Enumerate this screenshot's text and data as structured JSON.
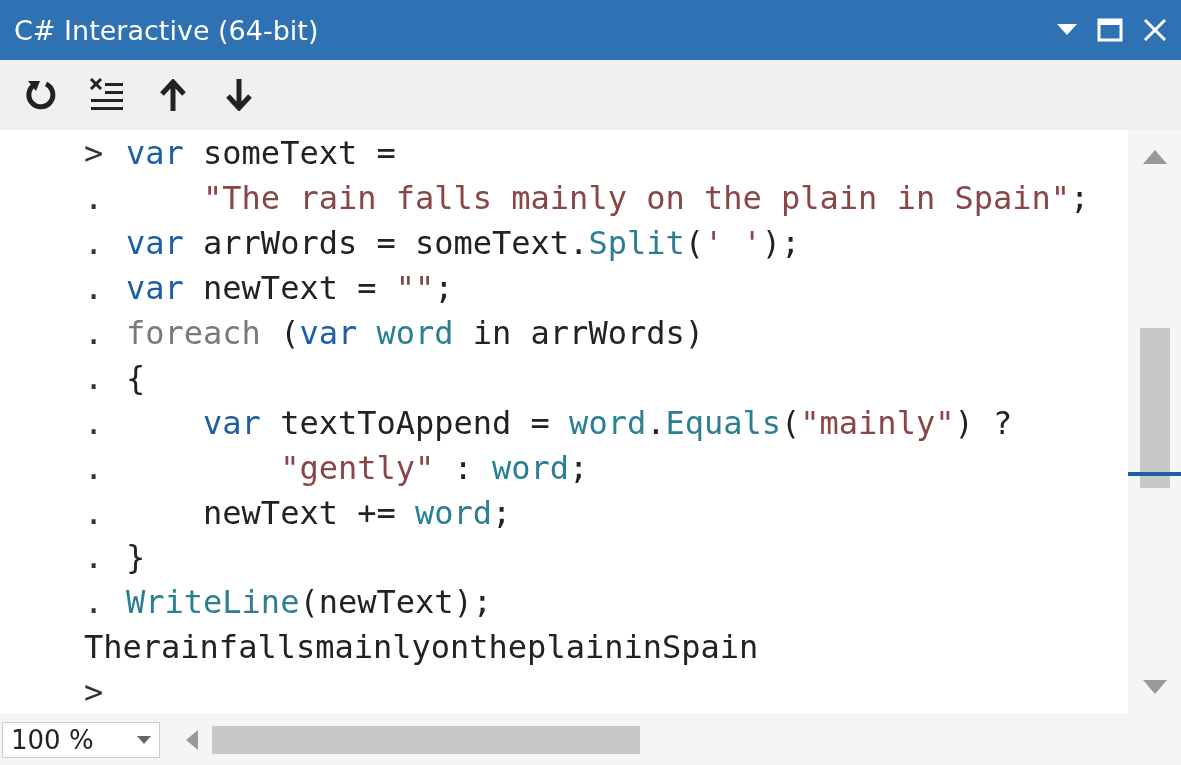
{
  "window": {
    "title": "C# Interactive (64-bit)"
  },
  "toolbar": {
    "buttons": [
      {
        "kind": "reset"
      },
      {
        "kind": "clear"
      },
      {
        "kind": "up"
      },
      {
        "kind": "down"
      }
    ]
  },
  "lines": [
    {
      "prompt": ">",
      "tokens": [
        {
          "kind": "keyword",
          "text": "var"
        },
        {
          "kind": "plain",
          "text": " someText ="
        }
      ]
    },
    {
      "prompt": ".",
      "tokens": [
        {
          "kind": "string",
          "text": "    \"The rain falls mainly on the plain in Spain\""
        },
        {
          "kind": "plain",
          "text": ";"
        }
      ]
    },
    {
      "prompt": ".",
      "tokens": [
        {
          "kind": "keyword",
          "text": "var"
        },
        {
          "kind": "plain",
          "text": " arrWords = someText."
        },
        {
          "kind": "method",
          "text": "Split"
        },
        {
          "kind": "plain",
          "text": "("
        },
        {
          "kind": "string",
          "text": "' '"
        },
        {
          "kind": "plain",
          "text": ");"
        }
      ]
    },
    {
      "prompt": ".",
      "tokens": [
        {
          "kind": "keyword",
          "text": "var"
        },
        {
          "kind": "plain",
          "text": " newText = "
        },
        {
          "kind": "string",
          "text": "\"\""
        },
        {
          "kind": "plain",
          "text": ";"
        }
      ]
    },
    {
      "prompt": ".",
      "tokens": [
        {
          "kind": "control",
          "text": "foreach"
        },
        {
          "kind": "plain",
          "text": " ("
        },
        {
          "kind": "keyword",
          "text": "var"
        },
        {
          "kind": "method",
          "text": " word"
        },
        {
          "kind": "plain",
          "text": " in arrWords)"
        }
      ]
    },
    {
      "prompt": ".",
      "tokens": [
        {
          "kind": "plain",
          "text": "{"
        }
      ]
    },
    {
      "prompt": ".",
      "tokens": [
        {
          "kind": "keyword",
          "text": "    var"
        },
        {
          "kind": "plain",
          "text": " textToAppend = "
        },
        {
          "kind": "method",
          "text": "word"
        },
        {
          "kind": "plain",
          "text": "."
        },
        {
          "kind": "method",
          "text": "Equals"
        },
        {
          "kind": "plain",
          "text": "("
        },
        {
          "kind": "string",
          "text": "\"mainly\""
        },
        {
          "kind": "plain",
          "text": ") ?"
        }
      ]
    },
    {
      "prompt": ".",
      "tokens": [
        {
          "kind": "string",
          "text": "        \"gently\""
        },
        {
          "kind": "plain",
          "text": " : "
        },
        {
          "kind": "method",
          "text": "word"
        },
        {
          "kind": "plain",
          "text": ";"
        }
      ]
    },
    {
      "prompt": ".",
      "tokens": [
        {
          "kind": "plain",
          "text": "    newText += "
        },
        {
          "kind": "method",
          "text": "word"
        },
        {
          "kind": "plain",
          "text": ";"
        }
      ]
    },
    {
      "prompt": ".",
      "tokens": [
        {
          "kind": "plain",
          "text": "}"
        }
      ]
    },
    {
      "prompt": ".",
      "tokens": [
        {
          "kind": "method",
          "text": "WriteLine"
        },
        {
          "kind": "plain",
          "text": "(newText);"
        }
      ]
    },
    {
      "output": "TherainfallsmainlyontheplaininSpain"
    },
    {
      "prompt": ">"
    }
  ],
  "zoom": {
    "value": "100 %"
  }
}
